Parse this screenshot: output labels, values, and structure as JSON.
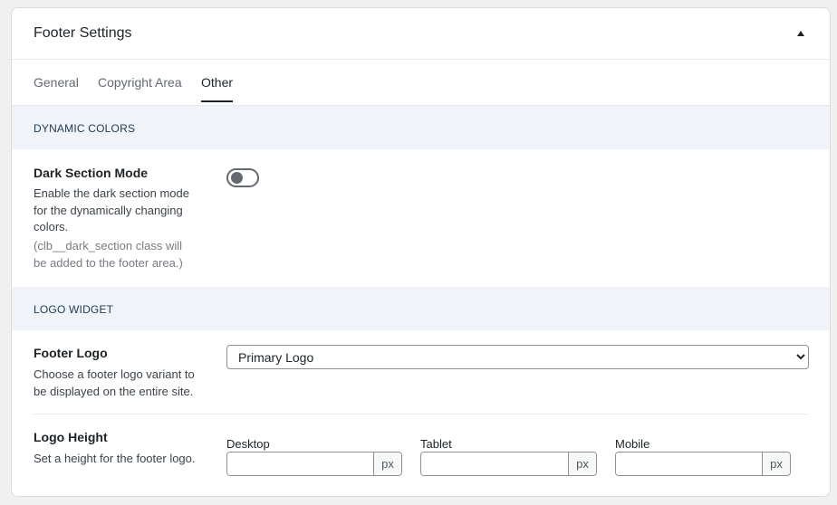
{
  "panel": {
    "title": "Footer Settings"
  },
  "tabs": [
    {
      "label": "General"
    },
    {
      "label": "Copyright Area"
    },
    {
      "label": "Other"
    }
  ],
  "active_tab": "Other",
  "sections": {
    "dynamic_colors": {
      "heading": "DYNAMIC COLORS",
      "dark_mode": {
        "label": "Dark Section Mode",
        "description": "Enable the dark section mode for the dynamically changing colors.",
        "note": "(clb__dark_section class will be added to the footer area.)",
        "enabled": false
      }
    },
    "logo_widget": {
      "heading": "LOGO WIDGET",
      "footer_logo": {
        "label": "Footer Logo",
        "description": "Choose a footer logo variant to be displayed on the entire site.",
        "selected": "Primary Logo"
      },
      "logo_height": {
        "label": "Logo Height",
        "description": "Set a height for the footer logo.",
        "desktop_label": "Desktop",
        "tablet_label": "Tablet",
        "mobile_label": "Mobile",
        "unit": "px",
        "desktop_value": "",
        "tablet_value": "",
        "mobile_value": ""
      }
    }
  }
}
